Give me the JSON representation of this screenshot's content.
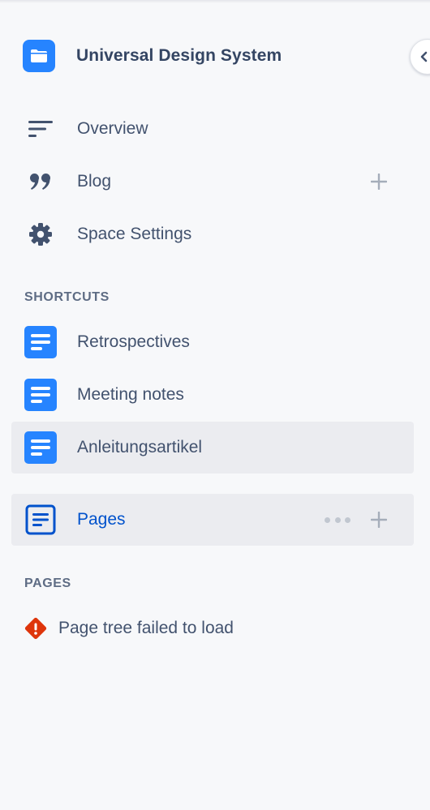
{
  "space": {
    "title": "Universal Design System"
  },
  "nav": {
    "overview": "Overview",
    "blog": "Blog",
    "space_settings": "Space Settings"
  },
  "shortcuts": {
    "heading": "SHORTCUTS",
    "items": [
      {
        "label": "Retrospectives"
      },
      {
        "label": "Meeting notes"
      },
      {
        "label": "Anleitungsartikel"
      }
    ]
  },
  "pages": {
    "label": "Pages",
    "heading": "PAGES",
    "error": "Page tree failed to load"
  },
  "colors": {
    "accent": "#2684ff",
    "link": "#0052cc",
    "selected_bg": "#ebecf0",
    "error": "#de350b"
  },
  "icons": {
    "space_logo": "folder-icon",
    "overview": "lines-icon",
    "blog": "quote-icon",
    "settings": "gear-icon",
    "shortcut": "document-icon",
    "pages": "page-icon",
    "error": "warning-icon",
    "collapse": "chevron-left-icon"
  }
}
